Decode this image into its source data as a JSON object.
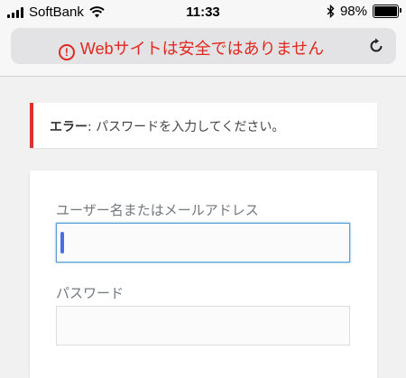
{
  "status_bar": {
    "carrier": "SoftBank",
    "time": "11:33",
    "battery_percent": "98%",
    "battery_level": 0.98
  },
  "browser": {
    "address_text": "Webサイトは安全ではありません",
    "warning_icon": "exclamation-circle-icon",
    "reload_icon": "reload-icon",
    "warning_color": "#e0281e"
  },
  "notice": {
    "label": "エラー",
    "message": ": パスワードを入力してください。",
    "accent_color": "#dc3232"
  },
  "login_form": {
    "username_label": "ユーザー名またはメールアドレス",
    "username_value": "",
    "password_label": "パスワード",
    "password_value": "",
    "focus_color": "#5b9dd9"
  }
}
